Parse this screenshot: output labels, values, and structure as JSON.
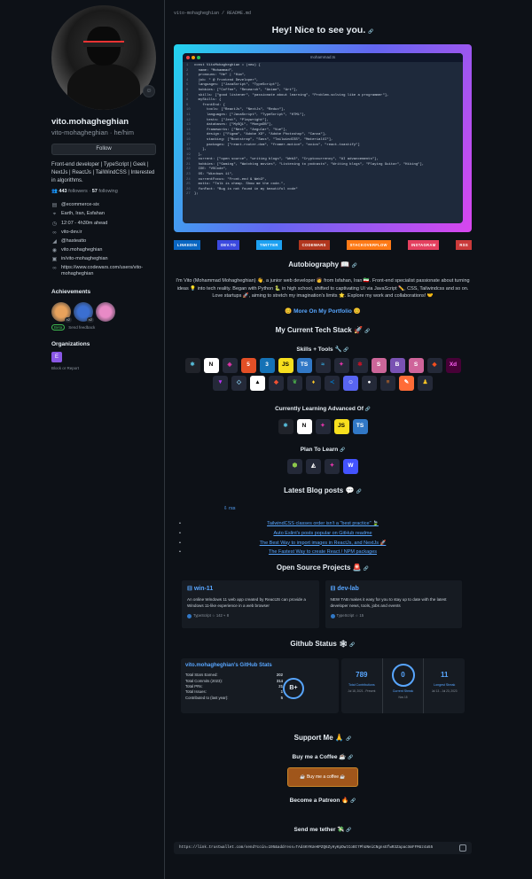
{
  "profile": {
    "full_name": "vito.mohagheghian",
    "username": "vito-mohagheghian · he/him",
    "follow_label": "Follow",
    "bio": "Front-end developer | TypeScript | Geek | NextJs | ReactJs | TailWindCSS | Interested in algorithms.",
    "followers_count": "443",
    "followers_label": "followers",
    "following_count": "57",
    "following_label": "following",
    "details": [
      {
        "icon": "building-icon",
        "glyph": "▤",
        "text": "@ecommerce-six"
      },
      {
        "icon": "location-icon",
        "glyph": "⌖",
        "text": "Earth, Iran, Esfahan"
      },
      {
        "icon": "clock-icon",
        "glyph": "◷",
        "text": "12:07 - 4h30m ahead"
      },
      {
        "icon": "link-icon",
        "glyph": "∞",
        "text": "vito-dev.ir"
      },
      {
        "icon": "twitter-icon",
        "glyph": "◢",
        "text": "@hasteatto"
      },
      {
        "icon": "instagram-icon",
        "glyph": "◉",
        "text": "vito.mohagheghian"
      },
      {
        "icon": "linkedin-icon",
        "glyph": "▣",
        "text": "in/vito-mohagheghian"
      },
      {
        "icon": "link-icon",
        "glyph": "∞",
        "text": "https://www.codewars.com/users/vito-mohagheghian"
      }
    ],
    "achievements_title": "Achievements",
    "achievements": [
      {
        "name": "pull-shark",
        "count": "x2",
        "color": "#e8a25c"
      },
      {
        "name": "starstruck",
        "count": "x2",
        "color": "#3b6fd1"
      },
      {
        "name": "yolo",
        "count": "",
        "color": "#e88ac6"
      }
    ],
    "beta_badge": "Beta",
    "beta_text": "Send feedback",
    "organizations_title": "Organizations",
    "org_initial": "E",
    "report_label": "Block or Report"
  },
  "readme": {
    "path": "vito-mohagheghian / README.md",
    "title": "Hey! Nice to see you.",
    "code_filename": "mohammad.ts",
    "code_lines": [
      "const VitoMohagheghian = (new) {",
      "  name: \"Mohammad\",",
      "  pronouns: \"He\" | \"Him\",",
      "  job: \" @ Frontend Developer\",",
      "  languages: [\"JavaScript\", \"TypeScript\"],",
      "  hobbies: [\"Coffee\", \"Research\", \"Anime\", \"Art\"],",
      "  skills: [\"good listener\", \"passionate about learning\", \"Problem-solving like a programmer\"],",
      "  mySkills: {",
      "    frontEnd: {",
      "      tools: [\"ReactJs\", \"NextJs\", \"Redux\"],",
      "      languages: [\"JavaScript\", \"TypeScript\", \"HTML\"],",
      "      tests: [\"Jest\", \"Playwright\"],",
      "      databases: [\"MySQL\", \"MongoDB\"],",
      "      frameworks: [\"Next\", \"Angular\", \"Vue\"],",
      "      design: [\"Figma\", \"Adobe XD\", \"Adobe Photoshop\", \"Canva\"],",
      "      stacking: [\"Bootstrap\", \"Sass\", \"TailwindCSS\", \"MaterialUI\"],",
      "      packages: [\"react-router-dom\", \"framer-motion\", \"axios\", \"react-toastify\"]",
      "    },",
      "  },",
      "  current: [\"open source\", \"writing blogs\", \"Web3\", \"Cryptocurrency\", \"AI advancements\"],",
      "  hobbies: [\"Gaming\", \"Watching movies\", \"Listening to podcasts\", \"Writing blogs\", \"Playing Guitar\", \"Hiking\"],",
      "  IDE: \"VSCode\",",
      "  OS: \"Windows 11\",",
      "  currentFocus: \"Front-end & Web3\",",
      "  motto: \"Talk is cheap. Show me the code.\",",
      "  funFact: \"Bug is not found in my beautiful code\"",
      "};"
    ],
    "socials": [
      {
        "label": "LinkedIn",
        "color": "#0a66c2"
      },
      {
        "label": "Dev.to",
        "color": "#3b49df"
      },
      {
        "label": "Twitter",
        "color": "#1da1f2"
      },
      {
        "label": "CodeWars",
        "color": "#b1361e"
      },
      {
        "label": "StackOverflow",
        "color": "#fe7a16"
      },
      {
        "label": "Instagram",
        "color": "#e4405f"
      },
      {
        "label": "RSS",
        "color": "#ca3a3a"
      }
    ],
    "autobio_title": "Autobiography 📖",
    "autobio": "I'm Vito (Mohammad Mohagheghian) 👋, a junior web developer 🧑 from Isfahan, Iran 🇮🇷. Front-end specialist passionate about turning ideas 💡 into tech reality. Began with Python 🐍 in high school, shifted to captivating UI via JavaScript ✏️, CSS, Tailwindcss and so on. Love startups 🚀, aiming to stretch my imagination's limits 🌟. Explore my work and collaborations! 🤝",
    "portfolio_label": "😊 More On My Portfolio 😊",
    "stack_title": "My Current Tech Stack 🚀",
    "skills_title": "Skills + Tools 🔧",
    "skills": [
      {
        "name": "react",
        "text": "⚛",
        "bg": "#20232a",
        "fg": "#61dafb"
      },
      {
        "name": "nextjs",
        "text": "N",
        "bg": "#ffffff",
        "fg": "#000000"
      },
      {
        "name": "graphql",
        "text": "◈",
        "bg": "#242938",
        "fg": "#e535ab"
      },
      {
        "name": "html",
        "text": "5",
        "bg": "#e34f26",
        "fg": "#ffffff"
      },
      {
        "name": "css",
        "text": "3",
        "bg": "#1572b6",
        "fg": "#ffffff"
      },
      {
        "name": "javascript",
        "text": "JS",
        "bg": "#f7df1e",
        "fg": "#000000"
      },
      {
        "name": "typescript",
        "text": "TS",
        "bg": "#3178c6",
        "fg": "#ffffff"
      },
      {
        "name": "tailwind",
        "text": "≈",
        "bg": "#242938",
        "fg": "#38bdf8"
      },
      {
        "name": "graphql2",
        "text": "✦",
        "bg": "#242938",
        "fg": "#e535ab"
      },
      {
        "name": "jest",
        "text": "✱",
        "bg": "#242938",
        "fg": "#c21325"
      },
      {
        "name": "styled",
        "text": "S",
        "bg": "#cc6699",
        "fg": "#ffffff"
      },
      {
        "name": "bootstrap",
        "text": "B",
        "bg": "#7952b3",
        "fg": "#ffffff"
      },
      {
        "name": "sass",
        "text": "S",
        "bg": "#cf649a",
        "fg": "#ffffff"
      },
      {
        "name": "figma",
        "text": "◆",
        "bg": "#242938",
        "fg": "#f24e1e"
      },
      {
        "name": "adobe-xd",
        "text": "Xd",
        "bg": "#470137",
        "fg": "#ff61f6"
      },
      {
        "name": "vite",
        "text": "▼",
        "bg": "#242938",
        "fg": "#bd34fe"
      },
      {
        "name": "webpack",
        "text": "◇",
        "bg": "#242938",
        "fg": "#8dd6f9"
      },
      {
        "name": "vercel",
        "text": "▲",
        "bg": "#ffffff",
        "fg": "#000000"
      },
      {
        "name": "git",
        "text": "◆",
        "bg": "#242938",
        "fg": "#f05032"
      },
      {
        "name": "mongodb",
        "text": "❦",
        "bg": "#242938",
        "fg": "#47a248"
      },
      {
        "name": "firebase",
        "text": "♦",
        "bg": "#242938",
        "fg": "#ffca28"
      },
      {
        "name": "vscode",
        "text": "≺",
        "bg": "#242938",
        "fg": "#007acc"
      },
      {
        "name": "discord",
        "text": "☺",
        "bg": "#5865f2",
        "fg": "#ffffff"
      },
      {
        "name": "github",
        "text": "●",
        "bg": "#242938",
        "fg": "#ffffff"
      },
      {
        "name": "stackoverflow",
        "text": "≡",
        "bg": "#242938",
        "fg": "#f48024"
      },
      {
        "name": "postman",
        "text": "✎",
        "bg": "#ff6c37",
        "fg": "#ffffff"
      },
      {
        "name": "linux",
        "text": "♟",
        "bg": "#242938",
        "fg": "#fcc624"
      }
    ],
    "learning_title": "Currently Learning Advanced Of",
    "learning": [
      {
        "name": "react",
        "text": "⚛",
        "bg": "#20232a",
        "fg": "#61dafb"
      },
      {
        "name": "nextjs",
        "text": "N",
        "bg": "#ffffff",
        "fg": "#000000"
      },
      {
        "name": "graphql",
        "text": "✦",
        "bg": "#242938",
        "fg": "#e535ab"
      },
      {
        "name": "javascript",
        "text": "JS",
        "bg": "#f7df1e",
        "fg": "#000000"
      },
      {
        "name": "typescript",
        "text": "TS",
        "bg": "#3178c6",
        "fg": "#ffffff"
      }
    ],
    "plan_title": "Plan To Learn",
    "plan": [
      {
        "name": "nodejs",
        "text": "⬢",
        "bg": "#242938",
        "fg": "#8cc84b"
      },
      {
        "name": "prisma",
        "text": "◭",
        "bg": "#242938",
        "fg": "#ffffff"
      },
      {
        "name": "graphql",
        "text": "✦",
        "bg": "#242938",
        "fg": "#e535ab"
      },
      {
        "name": "webflow",
        "text": "W",
        "bg": "#4353ff",
        "fg": "#ffffff"
      }
    ],
    "blog_title": "Latest Blog posts 💬",
    "rss_label": "⇩ rss",
    "posts": [
      "TailwindCSS classes order isn't a \"best practice\" 🍃",
      "Auto Eslint's posts popular on GitHub readme",
      "The Best Way to import images in ReactJs, and NextJs 🚀",
      "The Fastest Way to create React / NPM packages"
    ],
    "oss_title": "Open Source Projects 🚨",
    "repos": [
      {
        "name": "win-11",
        "description": "An online Windows 11 web app created by ReactJS can provide a Windows 11-like experience in a web browser",
        "language": "TypeScript",
        "stars": "142",
        "forks": "8"
      },
      {
        "name": "dev-lab",
        "description": "NEW TAB makes it easy for you to stay up to date with the latest developer news, tools, jobs and events",
        "language": "TypeScript",
        "stars": "15",
        "forks": ""
      }
    ],
    "gh_title": "Github Status 🕸",
    "stats": {
      "title": "vito.mohagheghian's GitHub Stats",
      "rows": [
        {
          "label": "Total Stars Earned:",
          "value": "202"
        },
        {
          "label": "Total Commits (2023):",
          "value": "314"
        },
        {
          "label": "Total PRs:",
          "value": "21"
        },
        {
          "label": "Total Issues:",
          "value": "1"
        },
        {
          "label": "Contributed to (last year):",
          "value": "5"
        }
      ],
      "grade": "B+"
    },
    "streak": {
      "total_value": "789",
      "total_label": "Total Contributions",
      "total_range": "Jul 18, 2021 - Present",
      "current_value": "0",
      "current_label": "Current Streak",
      "current_range": "Nov 15",
      "longest_value": "11",
      "longest_label": "Longest Streak",
      "longest_range": "Jul 13 - Jul 23, 2023"
    },
    "support_title": "Support Me 🙏",
    "coffee_title": "Buy me a Coffee ☕",
    "coffee_button": "☕ Buy me a coffee ☕",
    "patreon_title": "Become a Patreon 🔥",
    "tether_title": "Send me tether 💸",
    "tether_link": "https://link.trustwallet.com/send?coin=195&address=TAd4KYKUeKPZQ6ZyHyKpDwtCoBt7PhUNeiCNgnsEfwR3ZapacXmFFMUz4a55"
  }
}
